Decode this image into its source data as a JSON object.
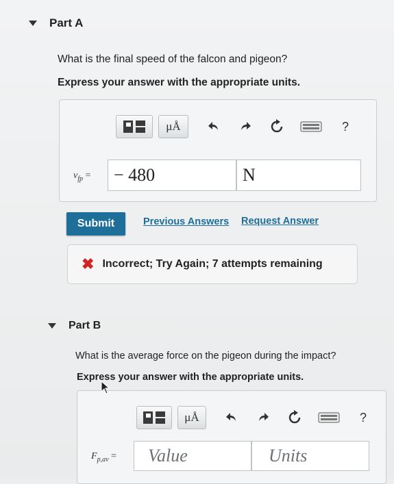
{
  "partA": {
    "header": "Part A",
    "question": "What is the final speed of the falcon and pigeon?",
    "instruction": "Express your answer with the appropriate units.",
    "toolbar": {
      "templates_icon": "templates-icon",
      "units_label": "μÅ",
      "undo_icon": "undo-icon",
      "redo_icon": "redo-icon",
      "reset_icon": "reset-icon",
      "keyboard_icon": "keyboard-icon",
      "help_label": "?"
    },
    "variable": "v",
    "variable_sub": "fp",
    "equals": "=",
    "value": "− 480",
    "units": "N",
    "submit_label": "Submit",
    "previous_answers": "Previous Answers",
    "request_answer": "Request Answer",
    "feedback_icon": "✖",
    "feedback_text": "Incorrect; Try Again; 7 attempts remaining"
  },
  "partB": {
    "header": "Part B",
    "question": "What is the average force on the pigeon during the impact?",
    "instruction": "Express your answer with the appropriate units.",
    "toolbar": {
      "units_label": "μÅ",
      "help_label": "?"
    },
    "variable": "F",
    "variable_sub": "p,av",
    "equals": "=",
    "value_placeholder": "Value",
    "units_placeholder": "Units"
  },
  "colors": {
    "accent": "#1d6f9a",
    "error": "#d32323"
  }
}
